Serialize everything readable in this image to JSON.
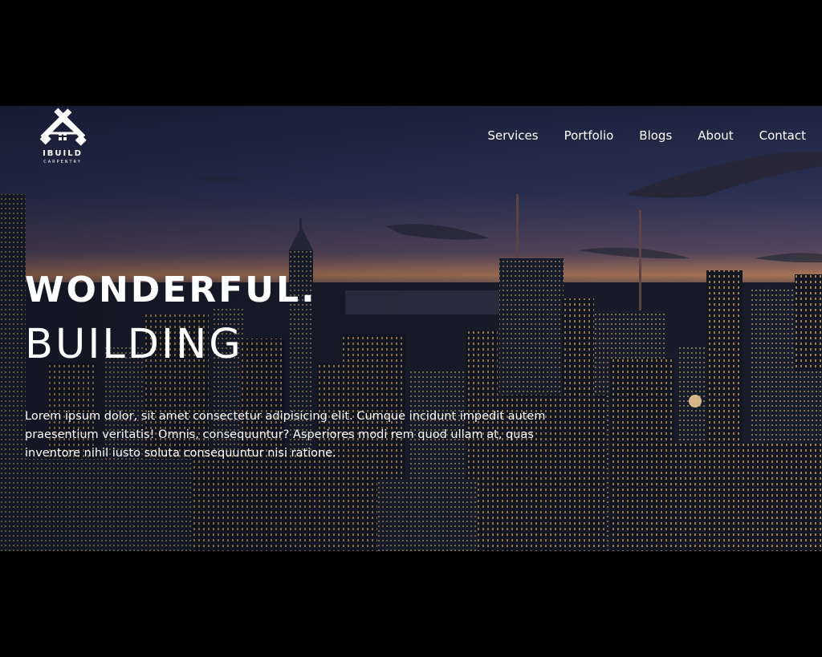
{
  "logo": {
    "brand": "IBUILD",
    "tagline": "CARPENTRY",
    "icon": "crossed-saws-house-icon"
  },
  "nav": {
    "items": [
      {
        "label": "Services"
      },
      {
        "label": "Portfolio"
      },
      {
        "label": "Blogs"
      },
      {
        "label": "About"
      },
      {
        "label": "Contact"
      }
    ]
  },
  "hero": {
    "headline_line1": "WONDERFUL.",
    "headline_line2": "BUILDING",
    "description": "Lorem ipsum dolor, sit amet consectetur adipisicing elit. Cumque incidunt impedit autem praesentium veritatis! Omnis, consequuntur? Asperiores modi rem quod ullam at, quas inventore nihil iusto soluta consequuntur nisi ratione.",
    "background_image": "city-skyline-at-dusk"
  },
  "colors": {
    "text": "#ffffff",
    "letterbox": "#000000"
  }
}
